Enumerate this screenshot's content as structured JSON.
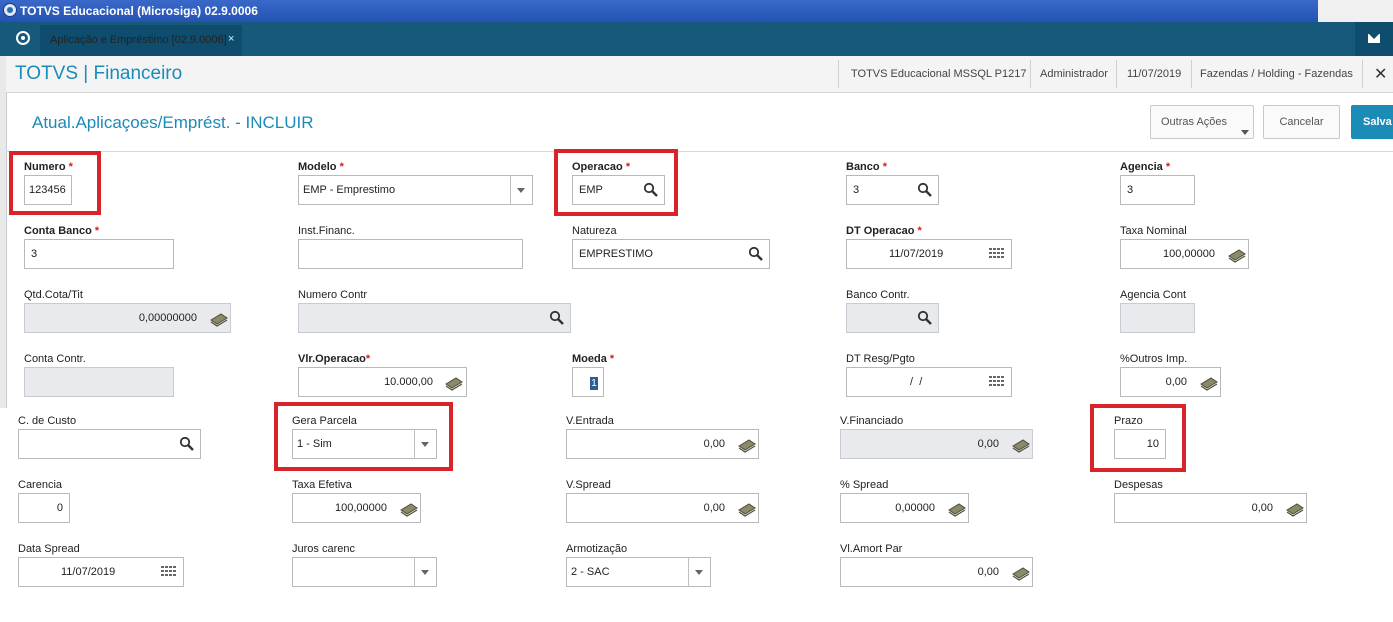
{
  "window": {
    "title": "TOTVS Educacional (Microsiga) 02.9.0006"
  },
  "tab": {
    "label": "Aplicação e Empréstimo [02.9.0006]",
    "close": "×"
  },
  "header": {
    "brand": "TOTVS | Financeiro",
    "environment": "TOTVS Educacional MSSQL P1217",
    "user": "Administrador",
    "date": "11/07/2019",
    "company": "Fazendas / Holding - Fazendas",
    "close": "✕"
  },
  "page": {
    "title": "Atual.Aplicaçoes/Emprést. - INCLUIR",
    "buttons": {
      "more": "Outras Ações",
      "cancel": "Cancelar",
      "save": "Salva"
    }
  },
  "fields": {
    "numero": {
      "label": "Numero",
      "value": "123456"
    },
    "modelo": {
      "label": "Modelo",
      "value": "EMP - Emprestimo"
    },
    "operacao": {
      "label": "Operacao",
      "value": "EMP"
    },
    "banco": {
      "label": "Banco",
      "value": "3"
    },
    "agencia": {
      "label": "Agencia",
      "value": "3"
    },
    "conta_banco": {
      "label": "Conta Banco",
      "value": "3"
    },
    "inst_financ": {
      "label": "Inst.Financ.",
      "value": ""
    },
    "natureza": {
      "label": "Natureza",
      "value": "EMPRESTIMO"
    },
    "dt_operacao": {
      "label": "DT Operacao",
      "value": "11/07/2019"
    },
    "taxa_nominal": {
      "label": "Taxa Nominal",
      "value": "100,00000"
    },
    "qtd_cota": {
      "label": "Qtd.Cota/Tit",
      "value": "0,00000000"
    },
    "numero_contr": {
      "label": "Numero Contr",
      "value": ""
    },
    "banco_contr": {
      "label": "Banco Contr.",
      "value": ""
    },
    "agencia_cont": {
      "label": "Agencia Cont",
      "value": ""
    },
    "conta_contr": {
      "label": "Conta Contr.",
      "value": ""
    },
    "vlr_operacao": {
      "label": "Vlr.Operacao",
      "value": "10.000,00"
    },
    "moeda": {
      "label": "Moeda",
      "value": "1"
    },
    "dt_resg": {
      "label": "DT Resg/Pgto",
      "value": " /  /"
    },
    "outros_imp": {
      "label": "%Outros Imp.",
      "value": "0,00"
    },
    "c_custo": {
      "label": "C. de Custo",
      "value": ""
    },
    "gera_parcela": {
      "label": "Gera Parcela",
      "value": "1 - Sim"
    },
    "v_entrada": {
      "label": "V.Entrada",
      "value": "0,00"
    },
    "v_financiado": {
      "label": "V.Financiado",
      "value": "0,00"
    },
    "prazo": {
      "label": "Prazo",
      "value": "10"
    },
    "carencia": {
      "label": "Carencia",
      "value": "0"
    },
    "taxa_efetiva": {
      "label": "Taxa Efetiva",
      "value": "100,00000"
    },
    "v_spread": {
      "label": "V.Spread",
      "value": "0,00"
    },
    "pct_spread": {
      "label": "% Spread",
      "value": "0,00000"
    },
    "despesas": {
      "label": "Despesas",
      "value": "0,00"
    },
    "data_spread": {
      "label": "Data Spread",
      "value": "11/07/2019"
    },
    "juros_carenc": {
      "label": "Juros carenc",
      "value": ""
    },
    "armotizacao": {
      "label": "Armotização",
      "value": "2 - SAC"
    },
    "vl_amort_par": {
      "label": "Vl.Amort Par",
      "value": "0,00"
    }
  },
  "required_mark": "*",
  "colors": {
    "accent": "#1b8bb8",
    "tabbar": "#16597a",
    "highlight": "#d8232a"
  }
}
